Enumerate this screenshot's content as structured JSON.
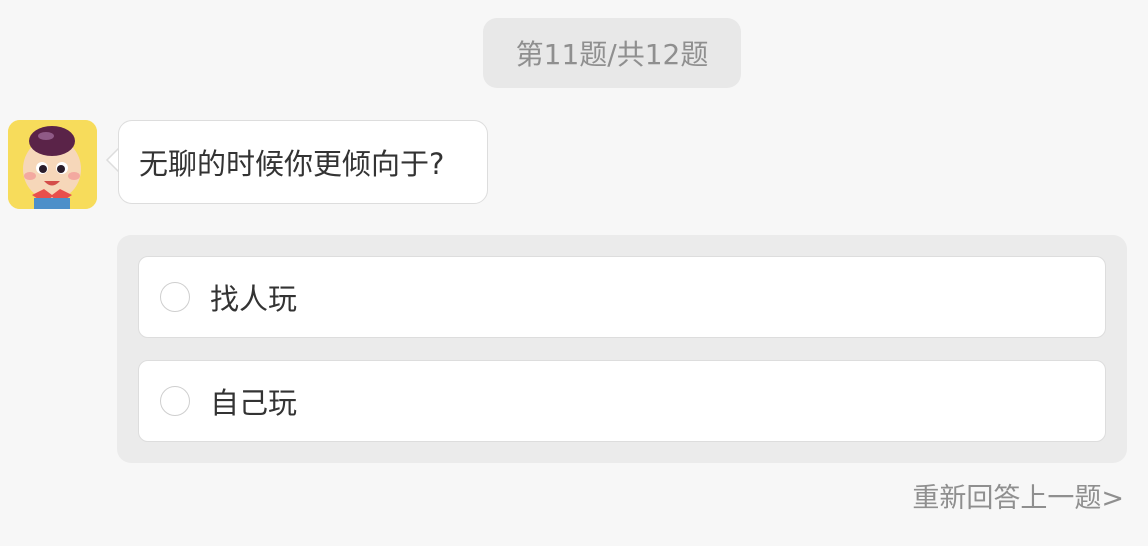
{
  "progress": {
    "text": "第11题/共12题"
  },
  "question": {
    "text": "无聊的时候你更倾向于?"
  },
  "options": [
    {
      "label": "找人玩"
    },
    {
      "label": "自己玩"
    }
  ],
  "footer": {
    "redo_label": "重新回答上一题>"
  },
  "colors": {
    "background": "#f7f7f7",
    "pill": "#e8e8e8",
    "panel": "#ebebeb",
    "avatar_bg": "#f7dc5b",
    "muted_text": "#8f8f8f"
  }
}
